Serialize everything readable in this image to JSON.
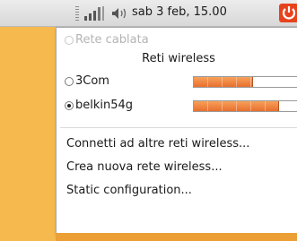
{
  "panel": {
    "network_icon": "wireless-signal-icon",
    "volume_icon": "speaker-volume-icon",
    "clock": "sab  3 feb, 15.00",
    "power_icon": "power-icon"
  },
  "menu": {
    "wired": "Rete cablata",
    "wireless_header": "Reti wireless",
    "networks": [
      {
        "name": "3Com",
        "selected": false,
        "signal": 0.55
      },
      {
        "name": "belkin54g",
        "selected": true,
        "signal": 0.8
      }
    ],
    "connect_other": "Connetti ad altre reti wireless...",
    "create_new": "Crea nuova rete wireless...",
    "static_config": "Static configuration..."
  },
  "colors": {
    "desktop": "#f5b94e",
    "signal_fill": "#e86f2e",
    "power": "#e8421c"
  }
}
